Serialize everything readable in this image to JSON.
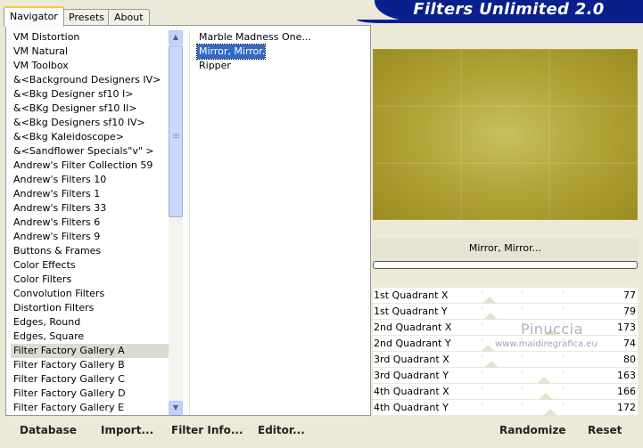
{
  "tabs": [
    {
      "label": "Navigator",
      "active": true
    },
    {
      "label": "Presets",
      "active": false
    },
    {
      "label": "About",
      "active": false
    }
  ],
  "banner": {
    "title": "Filters Unlimited 2.0"
  },
  "categories": [
    "VM Distortion",
    "VM Natural",
    "VM Toolbox",
    "&<Background Designers IV>",
    "&<Bkg Designer sf10 I>",
    "&<BKg Designer sf10 II>",
    "&<Bkg Designers sf10 IV>",
    "&<Bkg Kaleidoscope>",
    "&<Sandflower Specials\"v\" >",
    "Andrew's Filter Collection 59",
    "Andrew's Filters 10",
    "Andrew's Filters 1",
    "Andrew's Filters 33",
    "Andrew's Filters 6",
    "Andrew's Filters 9",
    "Buttons & Frames",
    "Color Effects",
    "Color Filters",
    "Convolution Filters",
    "Distortion Filters",
    "Edges, Round",
    "Edges, Square",
    "Filter Factory Gallery A",
    "Filter Factory Gallery B",
    "Filter Factory Gallery C",
    "Filter Factory Gallery D",
    "Filter Factory Gallery E"
  ],
  "selected_category": "Filter Factory Gallery A",
  "filters": [
    "Marble Madness One...",
    "Mirror, Mirror...",
    "Ripper"
  ],
  "selected_filter": "Mirror, Mirror...",
  "current_filter_name": "Mirror, Mirror...",
  "progress_fraction": 0.0,
  "colors": {
    "banner": "#0a1f8c",
    "selection": "#316ac5",
    "preview_center": "#c8c060",
    "preview_edge": "#9b8c20",
    "background": "#ece9d8"
  },
  "params": [
    {
      "label": "1st Quadrant X",
      "value": 77
    },
    {
      "label": "1st Quadrant Y",
      "value": 79
    },
    {
      "label": "2nd Quadrant X",
      "value": 173
    },
    {
      "label": "2nd Quadrant Y",
      "value": 74
    },
    {
      "label": "3rd Quadrant X",
      "value": 80
    },
    {
      "label": "3rd Quadrant Y",
      "value": 163
    },
    {
      "label": "4th Quadrant X",
      "value": 166
    },
    {
      "label": "4th Quadrant Y",
      "value": 172
    }
  ],
  "param_range": [
    0,
    255
  ],
  "watermark": {
    "line1": "Pinuccia",
    "line2": "www.maidiregrafica.eu"
  },
  "buttons": {
    "database": "Database",
    "import": "Import...",
    "filter_info": "Filter Info...",
    "editor": "Editor...",
    "randomize": "Randomize",
    "reset": "Reset"
  }
}
